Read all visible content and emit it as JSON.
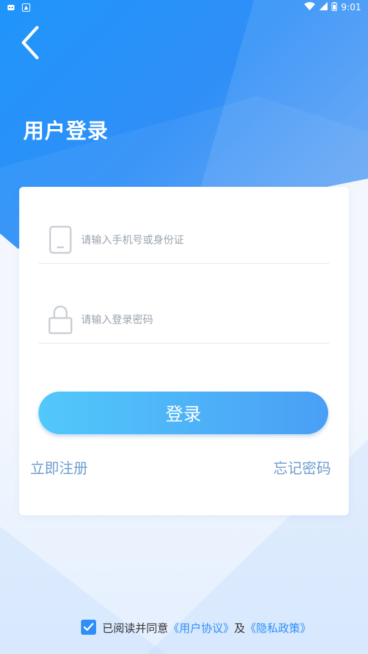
{
  "status_bar": {
    "time": "9:01",
    "left_icons": [
      "notification-icon",
      "app-icon"
    ],
    "right_icons": [
      "wifi-icon",
      "signal-icon",
      "battery-icon"
    ]
  },
  "header": {
    "back_icon": "chevron-left-icon",
    "title": "用户登录"
  },
  "form": {
    "phone": {
      "icon": "phone-icon",
      "value": "",
      "placeholder": "请输入手机号或身份证"
    },
    "password": {
      "icon": "lock-icon",
      "value": "",
      "placeholder": "请输入登录密码"
    },
    "login_label": "登录",
    "register_label": "立即注册",
    "forgot_label": "忘记密码"
  },
  "agreement": {
    "checked": true,
    "prefix": "已阅读并同意",
    "user_agreement": "《用户协议》",
    "conjunction": "及",
    "privacy_policy": "《隐私政策》"
  },
  "colors": {
    "primary": "#2f8ff7",
    "link": "#6f9dd0",
    "button_start": "#52c8fb",
    "button_end": "#4a9ff5"
  }
}
